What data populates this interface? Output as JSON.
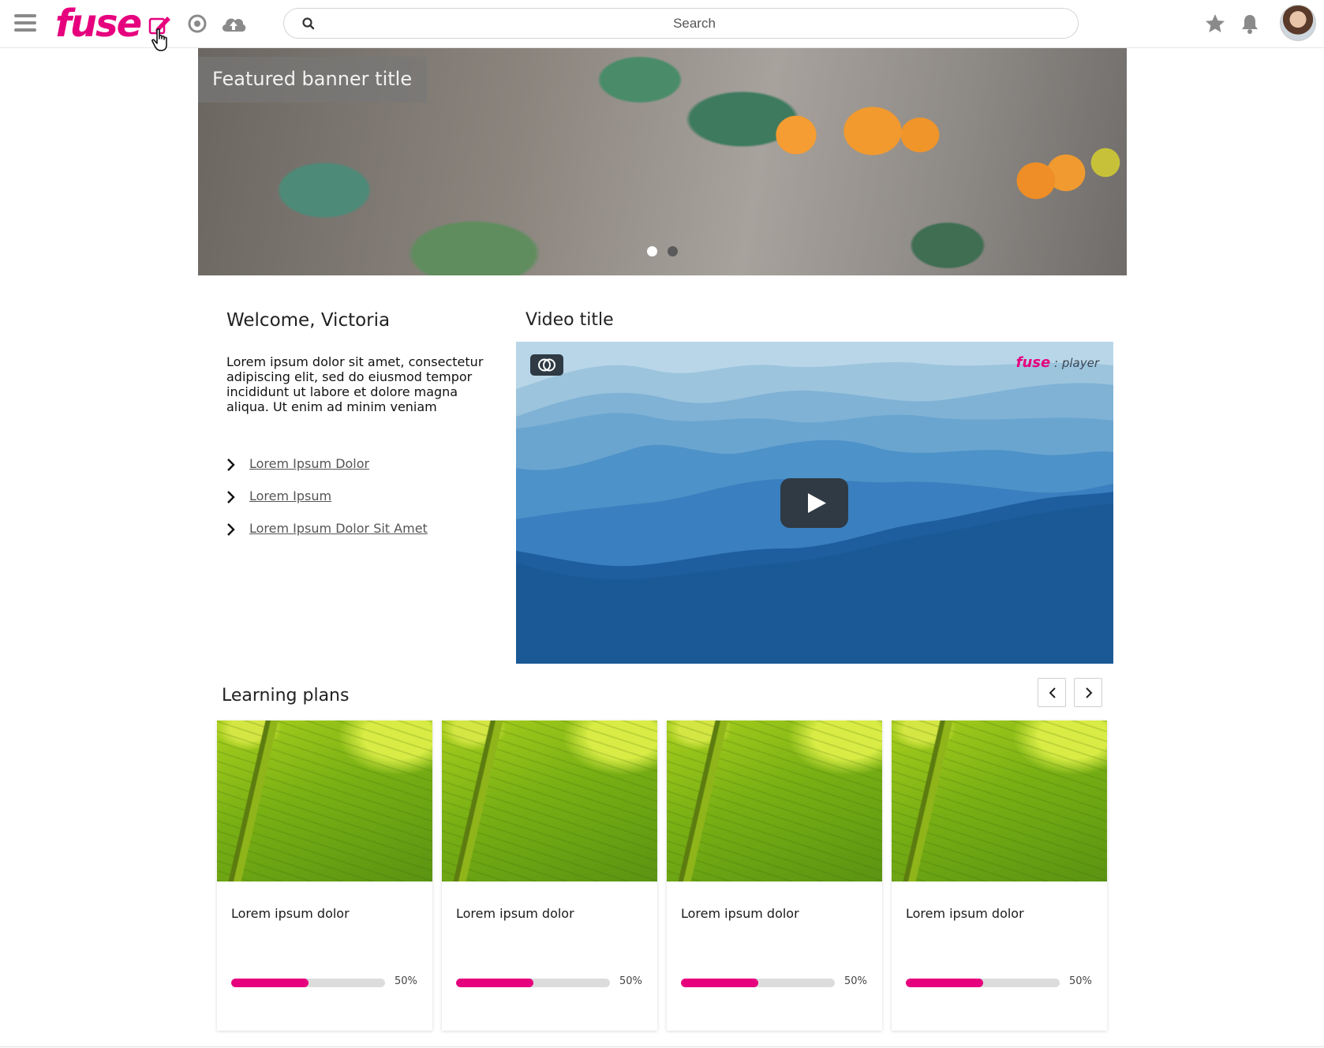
{
  "header": {
    "logo_text": "fuse",
    "search_placeholder": "Search",
    "icons": [
      "menu-icon",
      "edit-icon",
      "target-icon",
      "cloud-upload-icon",
      "star-icon",
      "bell-icon"
    ],
    "brand_color": "#e6007e"
  },
  "banner": {
    "title": "Featured banner title",
    "slides": 2,
    "active_slide": 1
  },
  "welcome": {
    "title": "Welcome, Victoria",
    "text": "Lorem ipsum dolor sit amet, consectetur adipiscing elit, sed do eiusmod tempor incididunt ut labore et dolore magna aliqua. Ut enim ad minim veniam",
    "links": [
      {
        "label": "Lorem Ipsum Dolor"
      },
      {
        "label": "Lorem Ipsum"
      },
      {
        "label": "Lorem Ipsum Dolor Sit Amet"
      }
    ]
  },
  "video": {
    "title": "Video title",
    "player_brand": "fuse",
    "player_brand_suffix": ": player"
  },
  "learning_plans": {
    "title": "Learning plans",
    "cards": [
      {
        "title": "Lorem ipsum dolor",
        "progress": 0.5,
        "progress_label": "50%"
      },
      {
        "title": "Lorem ipsum dolor",
        "progress": 0.5,
        "progress_label": "50%"
      },
      {
        "title": "Lorem ipsum dolor",
        "progress": 0.5,
        "progress_label": "50%"
      },
      {
        "title": "Lorem ipsum dolor",
        "progress": 0.5,
        "progress_label": "50%"
      }
    ]
  }
}
